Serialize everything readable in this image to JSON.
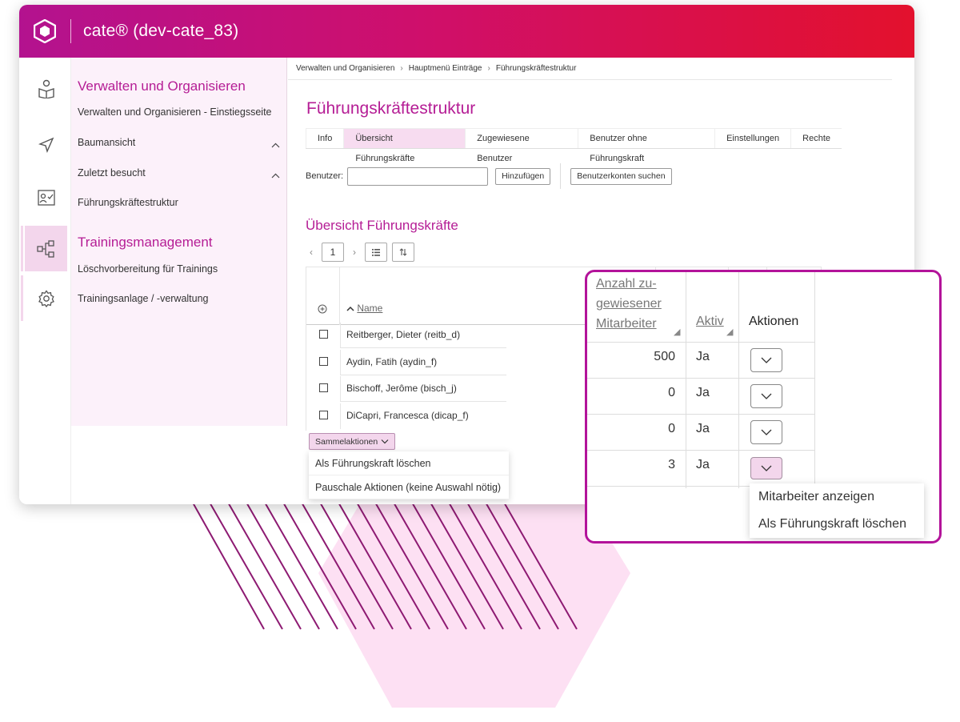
{
  "app": {
    "title": "cate® (dev-cate_83)"
  },
  "nav": {
    "heading1": "Verwalten und Organisieren",
    "item_start": "Verwalten und Organisieren - Einstiegsseite",
    "item_tree": "Baumansicht",
    "item_recent": "Zuletzt besucht",
    "item_leader": "Führungskräftestruktur",
    "heading2": "Trainingsmanagement",
    "item_delete_prep": "Löschvorbereitung für Trainings",
    "item_training_admin": "Trainingsanlage / -verwaltung"
  },
  "breadcrumb": [
    "Verwalten und Organisieren",
    "Hauptmenü Einträge",
    "Führungskräftestruktur"
  ],
  "page": {
    "title": "Führungskräftestruktur"
  },
  "tabs": [
    "Info",
    "Übersicht Führungskräfte",
    "Zugewiesene Benutzer",
    "Benutzer ohne Führungskraft",
    "Einstellungen",
    "Rechte"
  ],
  "user_search": {
    "label": "Benutzer:",
    "add_button": "Hinzufügen",
    "search_accounts_button": "Benutzerkonten suchen"
  },
  "overview": {
    "title": "Übersicht Führungskräfte",
    "page_number": "1",
    "name_header": "Name"
  },
  "rows": [
    {
      "name": "Reitberger, Dieter (reitb_d)",
      "count": "500",
      "active": "Ja"
    },
    {
      "name": "Aydin, Fatih (aydin_f)",
      "count": "0",
      "active": "Ja"
    },
    {
      "name": "Bischoff, Jerôme (bisch_j)",
      "count": "0",
      "active": "Ja"
    },
    {
      "name": "DiCapri, Francesca (dicap_f)",
      "count": "3",
      "active": "Ja"
    }
  ],
  "bulk": {
    "button": "Sammelaktionen",
    "menu": [
      "Als Führungskraft löschen",
      "Pauschale Aktionen (keine Auswahl nötig)"
    ]
  },
  "zoom": {
    "count_header_l1": "Anzahl zu-",
    "count_header_l2": "gewiesener",
    "count_header_l3": "Mitarbeiter",
    "active_header": "Aktiv",
    "actions_header": "Aktionen",
    "row_menu": [
      "Mitarbeiter anzeigen",
      "Als Führungskraft löschen"
    ]
  },
  "colors": {
    "brand": "#b51d95",
    "header_start": "#b3128f",
    "header_end": "#e3112d",
    "highlight": "#f3d6ec"
  }
}
